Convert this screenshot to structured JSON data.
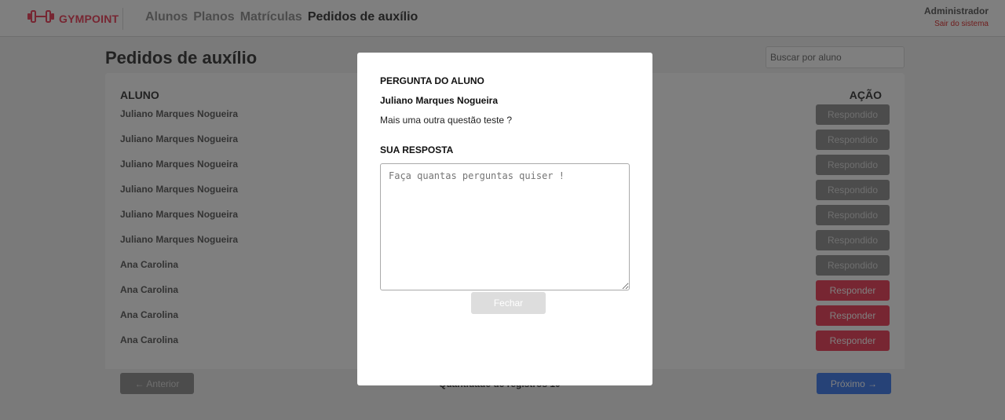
{
  "header": {
    "logo_text": "GYMPOINT",
    "nav": [
      {
        "label": "Alunos",
        "active": false
      },
      {
        "label": "Planos",
        "active": false
      },
      {
        "label": "Matrículas",
        "active": false
      },
      {
        "label": "Pedidos de auxílio",
        "active": true
      }
    ],
    "user_name": "Administrador",
    "logout_label": "Sair do sistema"
  },
  "page": {
    "title": "Pedidos de auxílio",
    "search_placeholder": "Buscar por aluno"
  },
  "table": {
    "col_student": "ALUNO",
    "col_action": "AÇÃO",
    "rows": [
      {
        "name": "Juliano Marques Nogueira",
        "action": "Respondido",
        "status": "answered"
      },
      {
        "name": "Juliano Marques Nogueira",
        "action": "Respondido",
        "status": "answered"
      },
      {
        "name": "Juliano Marques Nogueira",
        "action": "Respondido",
        "status": "answered"
      },
      {
        "name": "Juliano Marques Nogueira",
        "action": "Respondido",
        "status": "answered"
      },
      {
        "name": "Juliano Marques Nogueira",
        "action": "Respondido",
        "status": "answered"
      },
      {
        "name": "Juliano Marques Nogueira",
        "action": "Respondido",
        "status": "answered"
      },
      {
        "name": "Ana Carolina",
        "action": "Respondido",
        "status": "answered"
      },
      {
        "name": "Ana Carolina",
        "action": "Responder",
        "status": "pending"
      },
      {
        "name": "Ana Carolina",
        "action": "Responder",
        "status": "pending"
      },
      {
        "name": "Ana Carolina",
        "action": "Responder",
        "status": "pending"
      }
    ]
  },
  "pagination": {
    "prev_label": "← Anterior",
    "count_label": "Quantidade de registros 10",
    "next_label": "Próximo →"
  },
  "modal": {
    "question_heading": "PERGUNTA DO ALUNO",
    "student_name": "Juliano Marques Nogueira",
    "question_text": "Mais uma outra questão teste ?",
    "answer_heading": "SUA RESPOSTA",
    "answer_placeholder": "Faça quantas perguntas quiser !",
    "close_label": "Fechar"
  },
  "colors": {
    "brand": "#ee4d64",
    "answered": "#999999",
    "next_button": "#4d85ee"
  },
  "icons": {
    "logo": "dumbbell-icon"
  }
}
